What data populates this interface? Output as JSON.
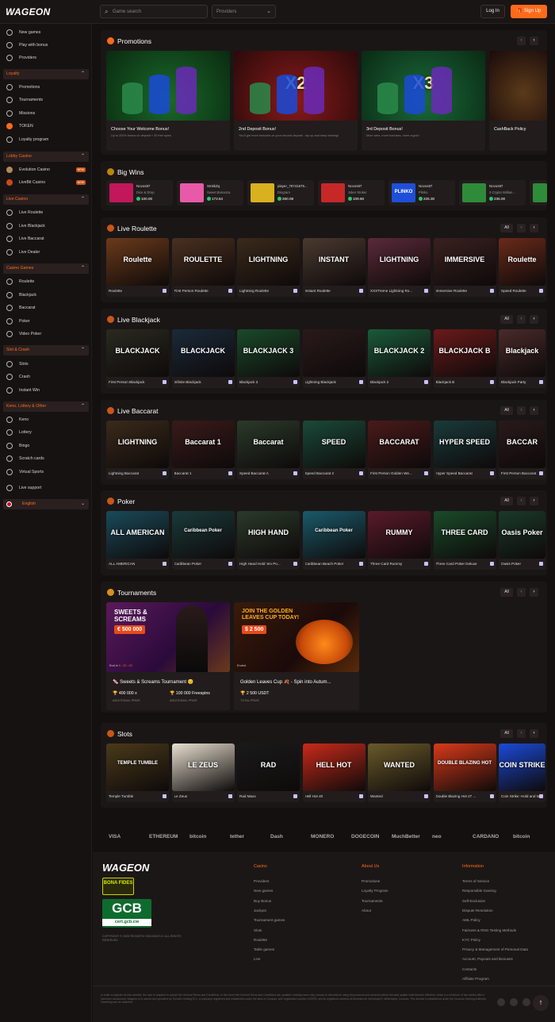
{
  "header": {
    "logo": "WAGEON",
    "search_placeholder": "Game search",
    "providers_label": "Providers",
    "login_label": "Log In",
    "signup_label": "Sign Up"
  },
  "sidebar": {
    "top_items": [
      "New games",
      "Play with bonus",
      "Providers"
    ],
    "groups": [
      {
        "label": "Loyalty",
        "items": [
          "Promotions",
          "Tournaments",
          "Missions",
          "TOKEN",
          "Loyalty program"
        ]
      },
      {
        "label": "Lobby Casino",
        "items": [
          "Evolution Casino",
          "LiveBit Casino"
        ],
        "badges": [
          "NEW",
          "NEW"
        ]
      },
      {
        "label": "Live Casino",
        "items": [
          "Live Roulette",
          "Live Blackjack",
          "Live Baccarat",
          "Live Dealer"
        ]
      },
      {
        "label": "Casino Games",
        "items": [
          "Roulette",
          "Blackjack",
          "Baccarat",
          "Poker",
          "Video Poker"
        ]
      },
      {
        "label": "Slot & Crash",
        "items": [
          "Slots",
          "Crash",
          "Instant Win"
        ]
      },
      {
        "label": "Keno, Lottery & Other",
        "items": [
          "Keno",
          "Lottery",
          "Bingo",
          "Scratch cards",
          "Virtual Sports"
        ]
      }
    ],
    "support": "Live support",
    "language": "English"
  },
  "promotions": {
    "title": "Promotions",
    "cards": [
      {
        "title": "Choose Your Welcome Bonus!",
        "desc": "Up to 200% bonus on deposit + 30 free spins",
        "overlay": ""
      },
      {
        "title": "2nd Deposit Bonus!",
        "desc": "You'll get more bonuses on your second deposit - top up and keep winning!",
        "overlay": "X2"
      },
      {
        "title": "3rd Deposit Bonus!",
        "desc": "More wins, more bonuses, more crypto!",
        "overlay": "X3"
      },
      {
        "title": "CashBack Policy",
        "desc": "",
        "overlay": ""
      }
    ]
  },
  "big_wins": {
    "title": "Big Wins",
    "items": [
      {
        "user": "Novos87",
        "game": "Dice & Drop",
        "amount": "100.00",
        "color": "#c2185b"
      },
      {
        "user": "SmkkZq",
        "game": "Sweet Bonanza",
        "amount": "173.64",
        "color": "#e85aa8"
      },
      {
        "user": "player_76741575...",
        "game": "Dingram",
        "amount": "260.08",
        "color": "#d8b020"
      },
      {
        "user": "Novos87",
        "game": "Joker Stoker",
        "amount": "109.60",
        "color": "#c62828"
      },
      {
        "user": "Novos87",
        "game": "Plinko",
        "amount": "226.30",
        "color": "#1e4fd8"
      },
      {
        "user": "Novos87",
        "game": "3 Crypto Willian...",
        "amount": "235.00",
        "color": "#2e8b3a"
      }
    ],
    "plinko_label": "PLINKO"
  },
  "live_roulette": {
    "title": "Live Roulette",
    "all": "All",
    "games": [
      {
        "name": "Roulette",
        "art": "Roulette",
        "bg": "#6b3a1a"
      },
      {
        "name": "First Person Roulette",
        "art": "ROULETTE",
        "bg": "#4a3020"
      },
      {
        "name": "Lightning Roulette",
        "art": "LIGHTNING",
        "bg": "#3a2a1a"
      },
      {
        "name": "Instant Roulette",
        "art": "INSTANT",
        "bg": "#4a3a30"
      },
      {
        "name": "XXXTreme Lightning Ro...",
        "art": "LIGHTNING",
        "bg": "#5a2a3a"
      },
      {
        "name": "Immersive Roulette",
        "art": "IMMERSIVE",
        "bg": "#3a2020"
      },
      {
        "name": "Speed Roulette",
        "art": "Roulette",
        "bg": "#6a2a1a"
      }
    ]
  },
  "live_blackjack": {
    "title": "Live Blackjack",
    "all": "All",
    "games": [
      {
        "name": "First Person Blackjack",
        "art": "BLACKJACK",
        "bg": "#2a2a20"
      },
      {
        "name": "Infinite Blackjack",
        "art": "BLACKJACK",
        "bg": "#1a2a3a"
      },
      {
        "name": "Blackjack 3",
        "art": "BLACKJACK 3",
        "bg": "#1a4a2a"
      },
      {
        "name": "Lightning Blackjack",
        "art": "",
        "bg": "#2a1a1a"
      },
      {
        "name": "Blackjack 2",
        "art": "BLACKJACK 2",
        "bg": "#1a5a3a"
      },
      {
        "name": "Blackjack B",
        "art": "BLACKJACK B",
        "bg": "#6a1a1a"
      },
      {
        "name": "Blackjack Party",
        "art": "Blackjack",
        "bg": "#4a2a2a"
      }
    ]
  },
  "live_baccarat": {
    "title": "Live Baccarat",
    "all": "All",
    "games": [
      {
        "name": "Lightning Baccarat",
        "art": "LIGHTNING",
        "bg": "#3a2a1a"
      },
      {
        "name": "Baccarat 1",
        "art": "Baccarat 1",
        "bg": "#3a1a1a"
      },
      {
        "name": "Speed Baccarat A",
        "art": "Baccarat",
        "bg": "#2a3a2a"
      },
      {
        "name": "Speed Baccarat 2",
        "art": "SPEED",
        "bg": "#1a4a3a"
      },
      {
        "name": "First Person Golden We...",
        "art": "BACCARAT",
        "bg": "#4a1a1a"
      },
      {
        "name": "Hyper Speed Baccarat",
        "art": "HYPER SPEED",
        "bg": "#1a3a3a"
      },
      {
        "name": "First Person Baccarat",
        "art": "BACCAR",
        "bg": "#2a1a1a"
      }
    ]
  },
  "poker": {
    "title": "Poker",
    "all": "All",
    "games": [
      {
        "name": "ALL AMERICAN",
        "art": "ALL AMERICAN",
        "bg": "#1a4a5a"
      },
      {
        "name": "Caribbean Poker",
        "art": "Caribbean Poker",
        "bg": "#1a3a3a"
      },
      {
        "name": "High Hand Hold 'em Po...",
        "art": "HIGH HAND",
        "bg": "#2a3a2a"
      },
      {
        "name": "Caribbean Beach Poker",
        "art": "Caribbean Poker",
        "bg": "#1a5a6a"
      },
      {
        "name": "Three Card Rummy",
        "art": "RUMMY",
        "bg": "#5a1a2a"
      },
      {
        "name": "Three Card Poker Deluxe",
        "art": "THREE CARD",
        "bg": "#1a4a2a"
      },
      {
        "name": "Oasis Poker",
        "art": "Oasis Poker",
        "bg": "#1a3a2a"
      }
    ]
  },
  "tournaments": {
    "title": "Tournaments",
    "all": "All",
    "cards": [
      {
        "banner": "SWEETS & SCREAMS",
        "prize_badge": "€ 500 000",
        "status": "End in",
        "timer": "5 : 22 : 02",
        "name": "Sweets & Screams Tournament",
        "stat1": "400 000 x",
        "sub1": "ADDITIONAL PRIZE",
        "stat2": "100 000 Freespins",
        "sub2": "ADDITIONAL PRIZE"
      },
      {
        "banner": "JOIN THE GOLDEN LEAVES CUP TODAY!",
        "prize_badge": "$ 2 500",
        "status": "Ended",
        "timer": "",
        "name": "Golden Leaves Cup 🍂 - Spin into Autum...",
        "stat1": "2 500 USDT",
        "sub1": "TOTAL PRIZE",
        "stat2": "",
        "sub2": ""
      }
    ]
  },
  "slots": {
    "title": "Slots",
    "all": "All",
    "games": [
      {
        "name": "Temple Tumble",
        "art": "TEMPLE TUMBLE",
        "bg": "#4a3a1a"
      },
      {
        "name": "Le Zeus",
        "art": "LE ZEUS",
        "bg": "#e8e0d0"
      },
      {
        "name": "Rad Maxx",
        "art": "RAD",
        "bg": "#1a1a1a"
      },
      {
        "name": "Hell Hot 40",
        "art": "HELL HOT",
        "bg": "#c82a1a"
      },
      {
        "name": "Wanted",
        "art": "WANTED",
        "bg": "#6a5a2a"
      },
      {
        "name": "Double Blazing Hot 27 ...",
        "art": "DOUBLE BLAZING HOT",
        "bg": "#d83a1a"
      },
      {
        "name": "Coin Strike: Hold and Win",
        "art": "COIN STRIKE",
        "bg": "#1a4ad8"
      }
    ]
  },
  "payments": [
    "VISA",
    "ETHEREUM",
    "bitcoin",
    "tether",
    "Dash",
    "MONERO",
    "DOGECOIN",
    "MuchBetter",
    "neo",
    "CARDANO",
    "bitcoin"
  ],
  "footer": {
    "logo": "WAGEON",
    "bona": "BONA FIDES",
    "gcb": "GCB",
    "gcb_sub": "cert.gcb.cw",
    "copyright": "COPYRIGHT © 2025 TECNOFIX HOLDING B.V. ALL RIGHTS RESERVED",
    "columns": [
      {
        "heading": "Casino",
        "links": [
          "Providers",
          "New games",
          "Buy Bonus",
          "Jackpot",
          "Tournament games",
          "Slots",
          "Roulette",
          "Table games",
          "Live"
        ]
      },
      {
        "heading": "About Us",
        "links": [
          "Promotions",
          "Loyalty Program",
          "Tournaments",
          "About"
        ]
      },
      {
        "heading": "Information",
        "links": [
          "Terms of Service",
          "Responsible Gaming",
          "Self-Exclusion",
          "Dispute Resolution",
          "AML Policy",
          "Fairness & RNG Testing Methods",
          "KYC Policy",
          "Privacy & Management of Personal Data",
          "Account, Payouts and Bonuses",
          "Contacts",
          "Affiliate Program"
        ]
      }
    ],
    "legal": "In order to register for this website, the user is required to accept the General Terms and Conditions. In the event the General Terms and Conditions are updated, existing users may choose to discontinue using the products and services before the said update shall become effective, which is a minimum of two weeks after it has been announced. Wageon.io is owned and operated by Tecnofix Holding B.V., a company registered and established under the laws of Curacao, with registration number 153978, and its registered address at Abraham de Veerstraat 9, Willemstad, Curacao. This license is established under the Curacao Gaming Authority. Gambling can be addictive.",
    "back_to_top": "↑"
  }
}
